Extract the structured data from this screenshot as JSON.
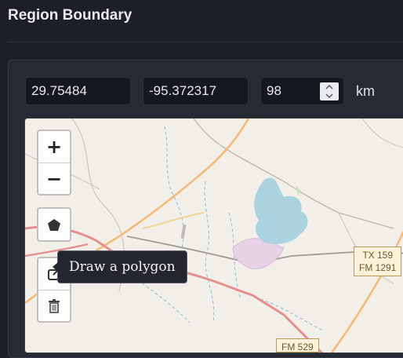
{
  "header": {
    "title": "Region Boundary"
  },
  "form": {
    "latitude": "29.75484",
    "longitude": "-95.372317",
    "radius": "98",
    "unit": "km"
  },
  "map": {
    "zoom_in": "+",
    "zoom_out": "−",
    "tooltip": "Draw a polygon",
    "road_labels": [
      "TX 159",
      "FM 1291",
      "FM 529"
    ]
  },
  "colors": {
    "background": "#1c1f26",
    "panel": "#262a33",
    "map_land": "#f2efe9",
    "water": "#aad3df",
    "road_major": "#f7b974",
    "road_highway": "#e58f8f"
  }
}
